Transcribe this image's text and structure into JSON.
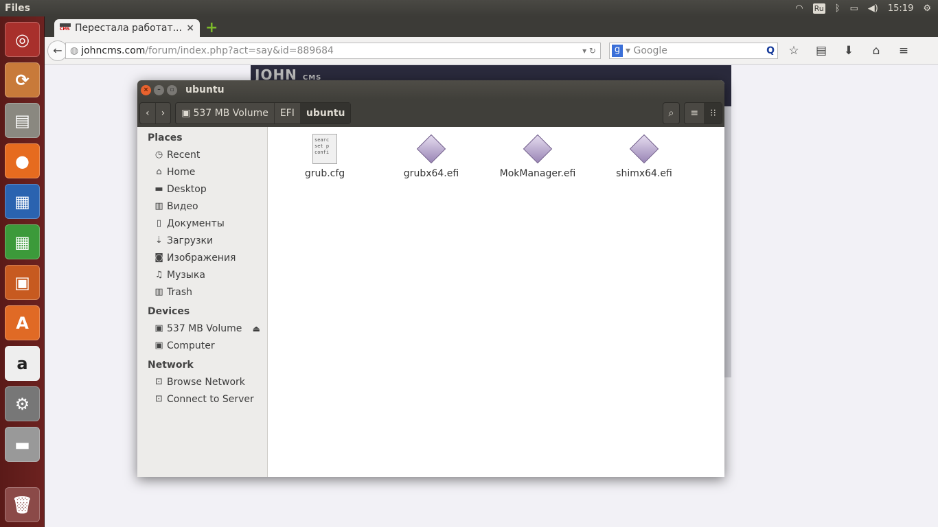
{
  "topbar": {
    "app_name": "Files",
    "keyboard": "Ru",
    "clock": "15:19"
  },
  "launcher": [
    {
      "name": "dash"
    },
    {
      "name": "software-updater"
    },
    {
      "name": "files"
    },
    {
      "name": "firefox"
    },
    {
      "name": "libreoffice-writer"
    },
    {
      "name": "libreoffice-calc"
    },
    {
      "name": "libreoffice-impress"
    },
    {
      "name": "software-center"
    },
    {
      "name": "amazon"
    },
    {
      "name": "system-settings"
    },
    {
      "name": "disk-drive"
    },
    {
      "name": "trash"
    }
  ],
  "browser": {
    "tab_title": "Перестала работат...",
    "url_host": "johncms.com",
    "url_path": "/forum/index.php?act=say&id=889684",
    "search_placeholder": "Google",
    "site_logo": "JOHN",
    "site_logo_small": "CMS"
  },
  "window": {
    "title": "ubuntu",
    "breadcrumbs": [
      "537 MB Volume",
      "EFI",
      "ubuntu"
    ]
  },
  "sidebar": {
    "places_heading": "Places",
    "places": [
      {
        "label": "Recent",
        "icon": "clock-icon"
      },
      {
        "label": "Home",
        "icon": "home-icon"
      },
      {
        "label": "Desktop",
        "icon": "folder-icon"
      },
      {
        "label": "Видео",
        "icon": "film-icon"
      },
      {
        "label": "Документы",
        "icon": "document-icon"
      },
      {
        "label": "Загрузки",
        "icon": "download-icon"
      },
      {
        "label": "Изображения",
        "icon": "camera-icon"
      },
      {
        "label": "Музыка",
        "icon": "music-icon"
      },
      {
        "label": "Trash",
        "icon": "trash-icon"
      }
    ],
    "devices_heading": "Devices",
    "devices": [
      {
        "label": "537 MB Volume"
      },
      {
        "label": "Computer"
      }
    ],
    "network_heading": "Network",
    "network": [
      {
        "label": "Browse Network"
      },
      {
        "label": "Connect to Server"
      }
    ]
  },
  "files": [
    {
      "name": "grub.cfg",
      "preview": "searc\nset p\nconfi"
    },
    {
      "name": "grubx64.efi"
    },
    {
      "name": "MokManager.efi"
    },
    {
      "name": "shimx64.efi"
    }
  ]
}
